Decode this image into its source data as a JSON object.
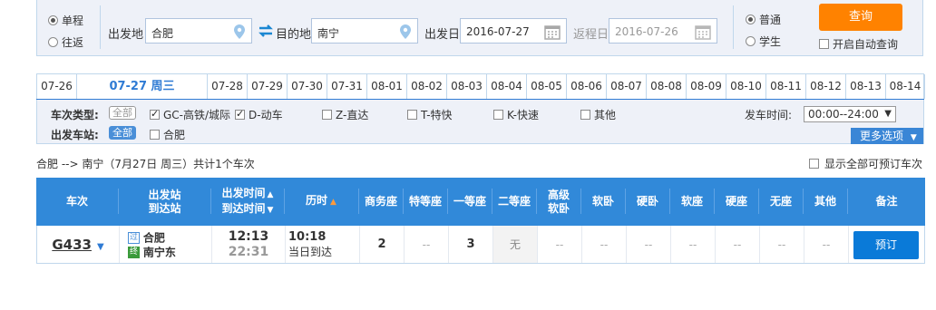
{
  "trip_type": {
    "one_way": "单程",
    "round_trip": "往返",
    "selected": "单程"
  },
  "from": {
    "label": "出发地",
    "value": "合肥"
  },
  "to": {
    "label": "目的地",
    "value": "南宁"
  },
  "depart_date": {
    "label": "出发日",
    "value": "2016-07-27"
  },
  "return_date": {
    "label": "返程日",
    "value": "2016-07-26"
  },
  "passenger": {
    "normal": "普通",
    "student": "学生",
    "selected": "普通"
  },
  "query_button": "查询",
  "auto_query": "开启自动查询",
  "date_tabs": [
    "07-26",
    "07-27 周三",
    "07-28",
    "07-29",
    "07-30",
    "07-31",
    "08-01",
    "08-02",
    "08-03",
    "08-04",
    "08-05",
    "08-06",
    "08-07",
    "08-08",
    "08-09",
    "08-10",
    "08-11",
    "08-12",
    "08-13",
    "08-14"
  ],
  "active_tab": "07-27 周三",
  "filters": {
    "train_type_label": "车次类型:",
    "all": "全部",
    "types": [
      {
        "label": "GC-高铁/城际",
        "checked": true
      },
      {
        "label": "D-动车",
        "checked": true
      },
      {
        "label": "Z-直达",
        "checked": false
      },
      {
        "label": "T-特快",
        "checked": false
      },
      {
        "label": "K-快速",
        "checked": false
      },
      {
        "label": "其他",
        "checked": false
      }
    ],
    "station_label": "出发车站:",
    "station_all": "全部",
    "stations": [
      {
        "label": "合肥",
        "checked": false
      }
    ],
    "time_label": "发车时间:",
    "time_value": "00:00--24:00",
    "more": "更多选项"
  },
  "summary": "合肥 --> 南宁（7月27日  周三）共计1个车次",
  "show_all_bookable": "显示全部可预订车次",
  "table": {
    "headers": {
      "train": "车次",
      "stations_1": "出发站",
      "stations_2": "到达站",
      "times_1": "出发时间",
      "times_2": "到达时间",
      "duration": "历时",
      "business": "商务座",
      "premium": "特等座",
      "first": "一等座",
      "second": "二等座",
      "soft_sleeper_hi_1": "高级",
      "soft_sleeper_hi_2": "软卧",
      "soft_sleeper": "软卧",
      "hard_sleeper": "硬卧",
      "soft_seat": "软座",
      "hard_seat": "硬座",
      "no_seat": "无座",
      "other": "其他",
      "remarks": "备注"
    },
    "rows": [
      {
        "train": "G433",
        "from_tag": "过",
        "from": "合肥",
        "to_tag": "终",
        "to": "南宁东",
        "depart": "12:13",
        "arrive": "22:31",
        "duration": "10:18",
        "arrival_day": "当日到达",
        "business": "2",
        "premium": "--",
        "first": "3",
        "second": "无",
        "soft_sleeper_hi": "--",
        "soft_sleeper": "--",
        "hard_sleeper": "--",
        "soft_seat": "--",
        "hard_seat": "--",
        "no_seat": "--",
        "other": "--",
        "book": "预订"
      }
    ]
  },
  "colors": {
    "accent": "#3189d9",
    "query_button": "#ff8200",
    "book_button": "#0a7ad8",
    "panel_bg": "#eef1f8"
  }
}
